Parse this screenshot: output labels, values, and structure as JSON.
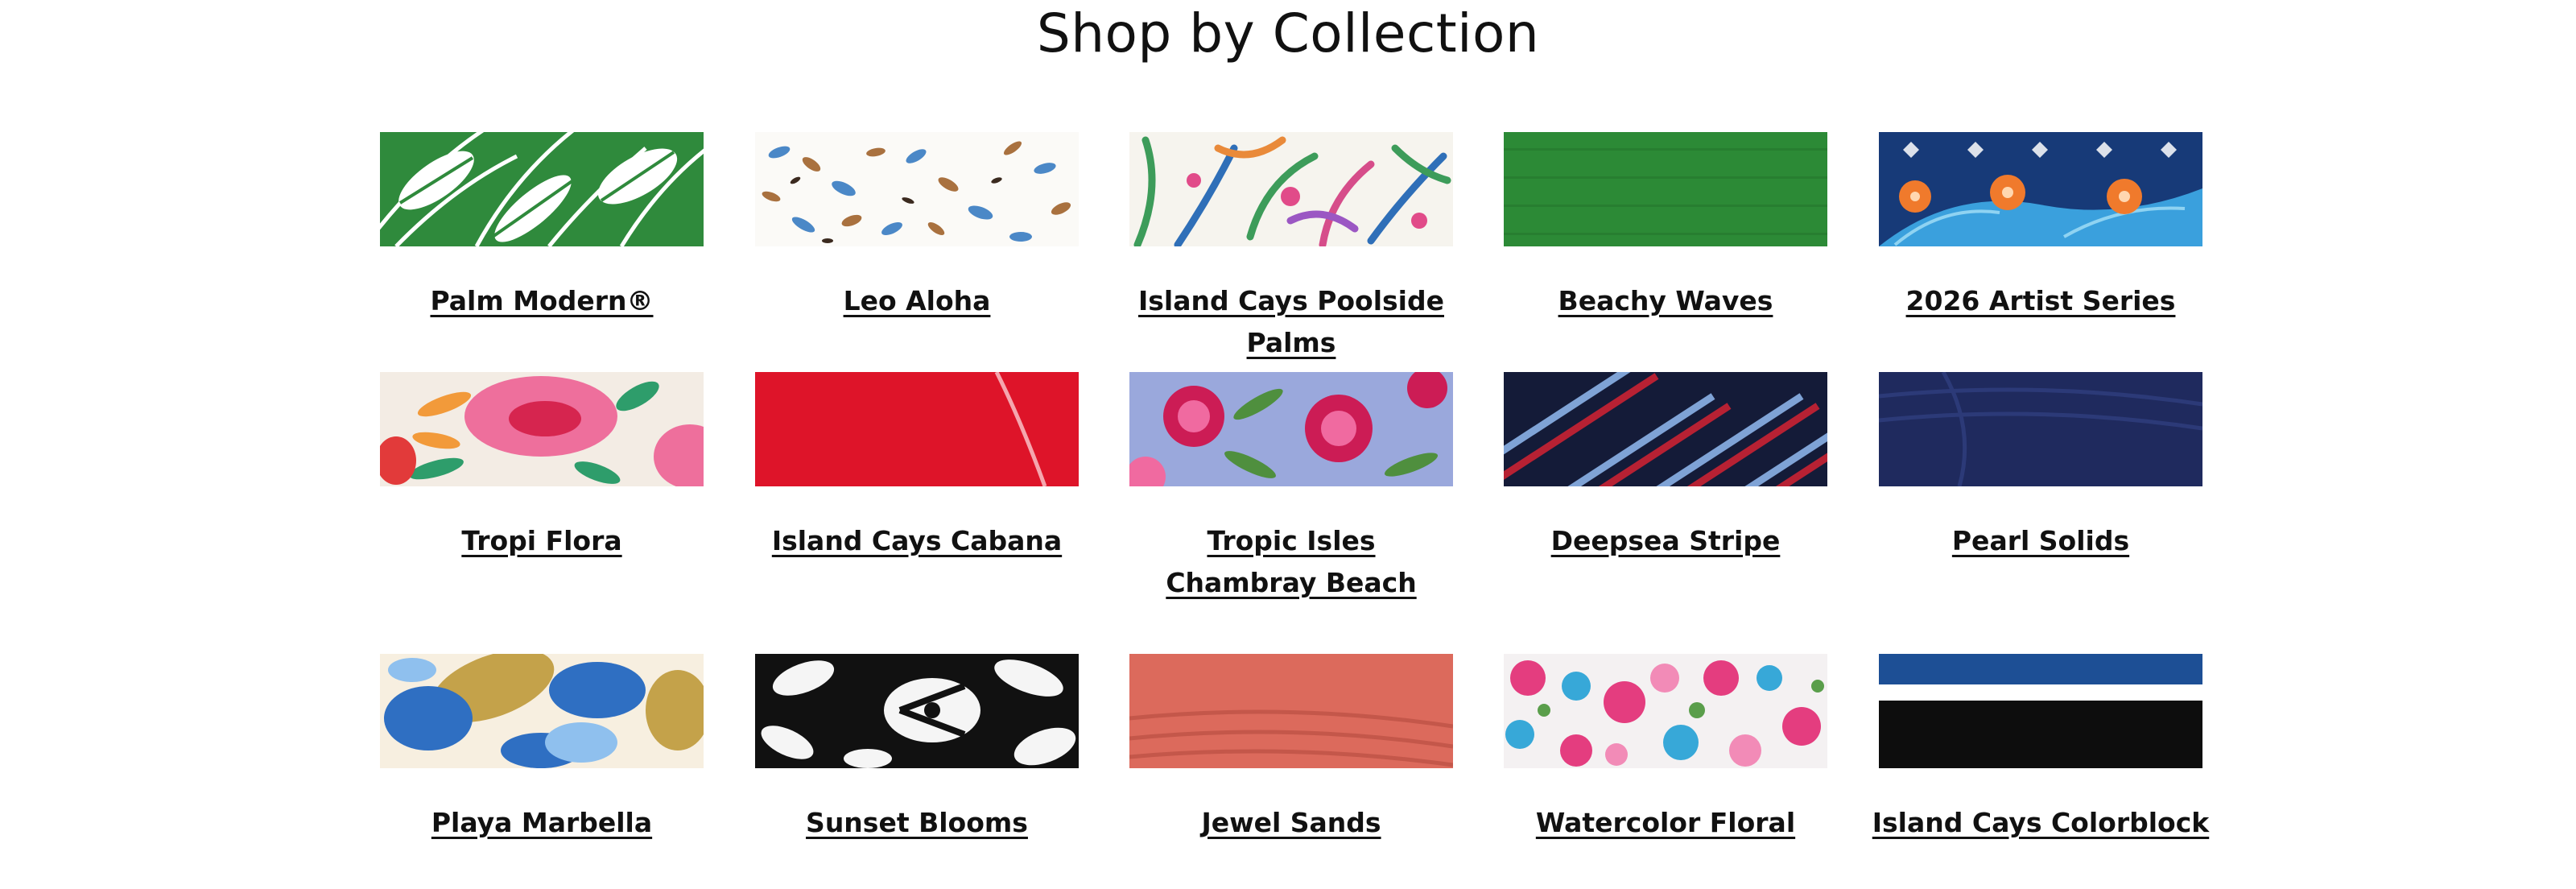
{
  "page": {
    "title": "Shop by Collection"
  },
  "collections": [
    {
      "label": "Palm Modern®",
      "swatch": "palm-leaf-print",
      "colors": [
        "#2f8a3c",
        "#ffffff"
      ]
    },
    {
      "label": "Leo Aloha",
      "swatch": "leopard-print",
      "colors": [
        "#ffffff",
        "#4b88c7",
        "#a9713f"
      ]
    },
    {
      "label": "Island Cays Poolside Palms",
      "swatch": "tropical-palm-print",
      "colors": [
        "#f6f4ee",
        "#3d9c5a",
        "#2f6fb8",
        "#d64d8a"
      ]
    },
    {
      "label": "Beachy Waves",
      "swatch": "solid-green-texture",
      "colors": [
        "#2c8a36"
      ]
    },
    {
      "label": "2026 Artist Series",
      "swatch": "tile-floral-print",
      "colors": [
        "#173a78",
        "#3aa0dd",
        "#f07a2c"
      ]
    },
    {
      "label": "Tropi Flora",
      "swatch": "hibiscus-print",
      "colors": [
        "#f3ece4",
        "#ee6f9c",
        "#2e9d6b"
      ]
    },
    {
      "label": "Island Cays Cabana",
      "swatch": "solid-red",
      "colors": [
        "#de1429"
      ]
    },
    {
      "label": "Tropic Isles\nChambray Beach",
      "swatch": "chambray-floral-print",
      "colors": [
        "#9aa8dc",
        "#cc1c55",
        "#f06aa0"
      ]
    },
    {
      "label": "Deepsea Stripe",
      "swatch": "diagonal-stripe",
      "colors": [
        "#141b38",
        "#b72133",
        "#7fa3d6"
      ]
    },
    {
      "label": "Pearl Solids",
      "swatch": "solid-navy-ruched",
      "colors": [
        "#1f2a5e"
      ]
    },
    {
      "label": "Playa Marbella",
      "swatch": "watercolor-botanical-print",
      "colors": [
        "#c4a24a",
        "#2f6fc2",
        "#f7efe0"
      ]
    },
    {
      "label": "Sunset Blooms",
      "swatch": "black-white-hibiscus-print",
      "colors": [
        "#111111",
        "#f5f5f5"
      ]
    },
    {
      "label": "Jewel Sands",
      "swatch": "solid-coral-ruched",
      "colors": [
        "#dc6a5c"
      ]
    },
    {
      "label": "Watercolor Floral",
      "swatch": "multicolor-floral-print",
      "colors": [
        "#e43d7f",
        "#37a8d8",
        "#f28bb7"
      ]
    },
    {
      "label": "Island Cays Colorblock",
      "swatch": "colorblock",
      "colors": [
        "#1d4f95",
        "#ffffff",
        "#0d0d0d"
      ]
    }
  ]
}
